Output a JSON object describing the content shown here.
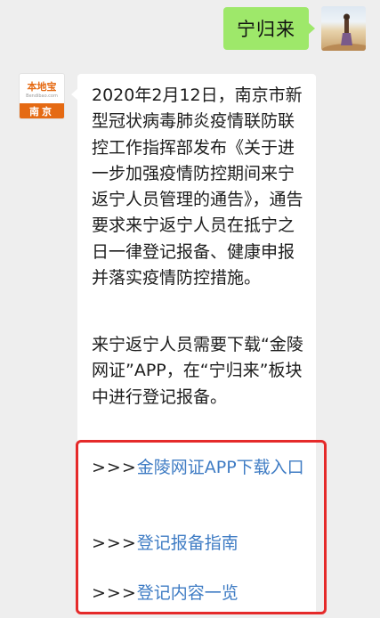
{
  "messages": {
    "outgoing": {
      "text": "宁归来"
    },
    "incoming": {
      "sender_logo_text": "本地宝",
      "sender_logo_url": "Bendibao.com",
      "sender_city": "南京",
      "paragraph_1": "2020年2月12日，南京市新型冠状病毒肺炎疫情联防联控工作指挥部发布《关于进一步加强疫情防控期间来宁返宁人员管理的通告》，通告要求来宁返宁人员在抵宁之日一律登记报备、健康申报并落实疫情防控措施。",
      "paragraph_2": "来宁返宁人员需要下载“金陵网证”APP，在“宁归来”板块中进行登记报备。",
      "links": [
        {
          "prefix": ">>>",
          "label": "金陵网证APP下载入口"
        },
        {
          "prefix": ">>>",
          "label": "登记报备指南"
        },
        {
          "prefix": ">>>",
          "label": "登记内容一览"
        }
      ]
    }
  },
  "colors": {
    "background": "#eeeeee",
    "outgoing_bubble": "#9ee86a",
    "incoming_bubble": "#ffffff",
    "link": "#3f7cc4",
    "highlight_border": "#e52a2a",
    "brand_orange": "#e56a13"
  }
}
